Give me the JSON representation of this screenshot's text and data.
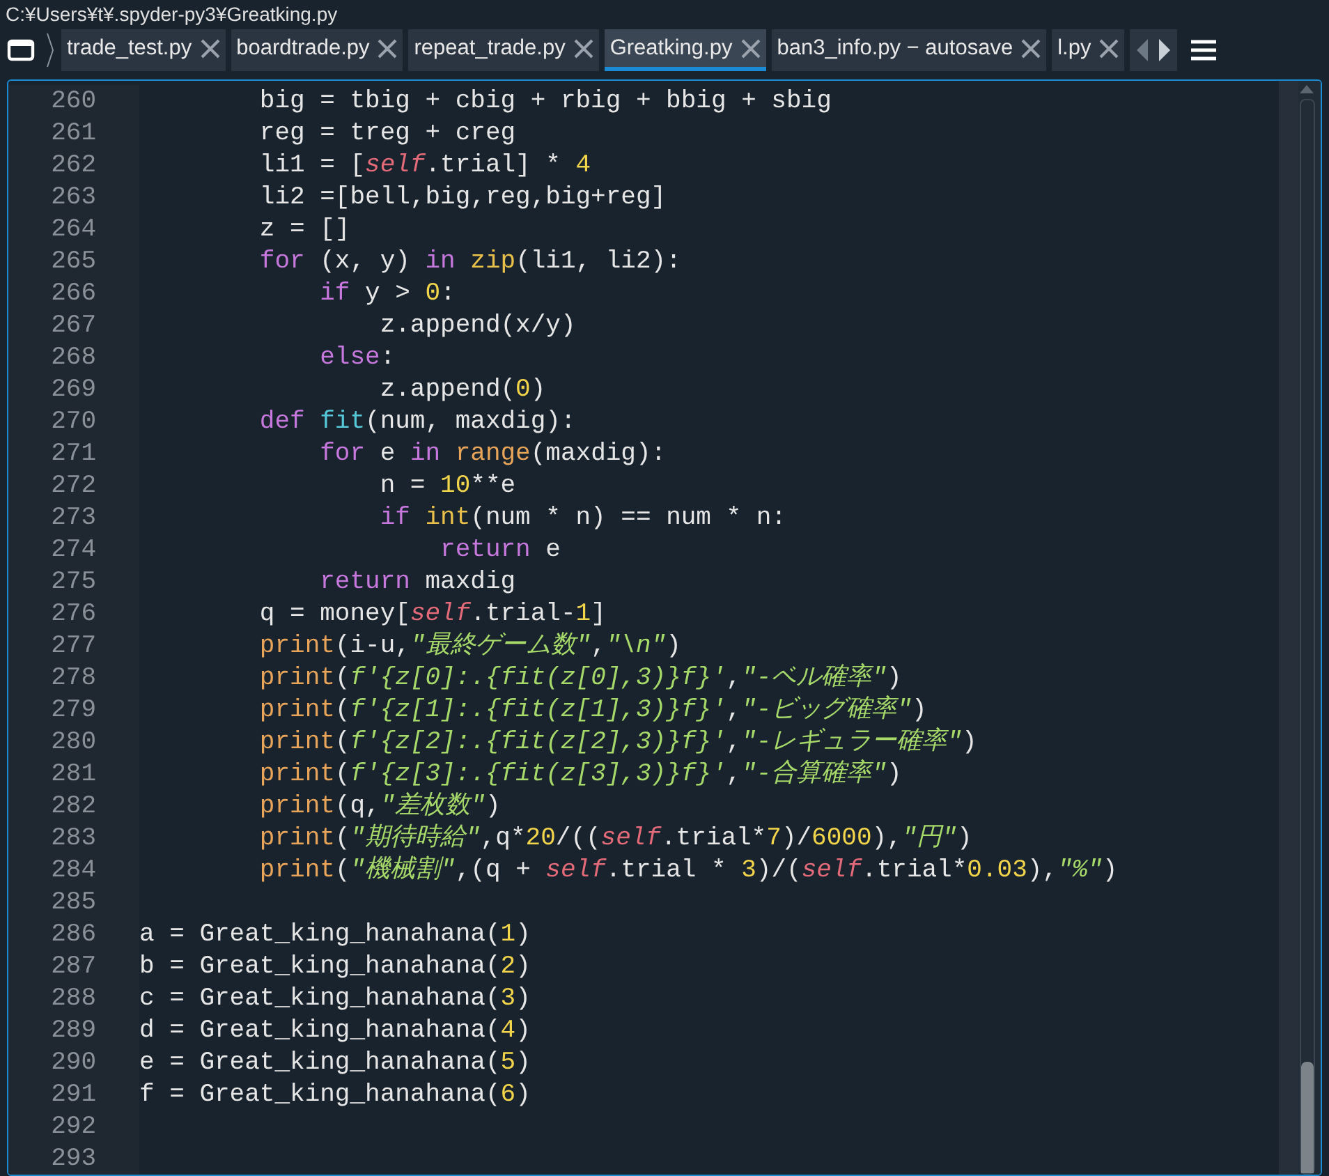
{
  "title_bar": {
    "path": "C:¥Users¥t¥.spyder-py3¥Greatking.py"
  },
  "tabs": [
    {
      "label": "trade_test.py",
      "selected": false
    },
    {
      "label": "boardtrade.py",
      "selected": false
    },
    {
      "label": "repeat_trade.py",
      "selected": false
    },
    {
      "label": "Greatking.py",
      "selected": true
    },
    {
      "label": "ban3_info.py − autosave",
      "selected": false
    },
    {
      "label": "l.py",
      "selected": false
    }
  ],
  "lines": [
    {
      "number": "260",
      "tokens": [
        {
          "kind": "plain",
          "text": "        big = tbig + cbig + rbig + bbig + sbig"
        }
      ]
    },
    {
      "number": "261",
      "tokens": [
        {
          "kind": "plain",
          "text": "        reg = treg + creg"
        }
      ]
    },
    {
      "number": "262",
      "tokens": [
        {
          "kind": "plain",
          "text": "        li1 = ["
        },
        {
          "kind": "self",
          "text": "self"
        },
        {
          "kind": "plain",
          "text": ".trial] * "
        },
        {
          "kind": "number",
          "text": "4"
        }
      ]
    },
    {
      "number": "263",
      "tokens": [
        {
          "kind": "plain",
          "text": "        li2 =[bell,big,reg,big+reg]"
        }
      ]
    },
    {
      "number": "264",
      "tokens": [
        {
          "kind": "plain",
          "text": "        z = []"
        }
      ]
    },
    {
      "number": "265",
      "tokens": [
        {
          "kind": "keyword",
          "text": "        for"
        },
        {
          "kind": "plain",
          "text": " (x, y) "
        },
        {
          "kind": "keyword",
          "text": "in "
        },
        {
          "kind": "builtin",
          "text": "zip"
        },
        {
          "kind": "plain",
          "text": "(li1, li2):"
        }
      ]
    },
    {
      "number": "266",
      "tokens": [
        {
          "kind": "keyword",
          "text": "            if"
        },
        {
          "kind": "plain",
          "text": " y > "
        },
        {
          "kind": "number",
          "text": "0"
        },
        {
          "kind": "plain",
          "text": ":"
        }
      ]
    },
    {
      "number": "267",
      "tokens": [
        {
          "kind": "plain",
          "text": "                z.append(x/y)"
        }
      ]
    },
    {
      "number": "268",
      "tokens": [
        {
          "kind": "keyword",
          "text": "            else"
        },
        {
          "kind": "plain",
          "text": ":"
        }
      ]
    },
    {
      "number": "269",
      "tokens": [
        {
          "kind": "plain",
          "text": "                z.append("
        },
        {
          "kind": "number",
          "text": "0"
        },
        {
          "kind": "plain",
          "text": ")"
        }
      ]
    },
    {
      "number": "270",
      "tokens": [
        {
          "kind": "keyword",
          "text": "        def "
        },
        {
          "kind": "function",
          "text": "fit"
        },
        {
          "kind": "plain",
          "text": "(num, maxdig):"
        }
      ]
    },
    {
      "number": "271",
      "tokens": [
        {
          "kind": "keyword",
          "text": "            for"
        },
        {
          "kind": "plain",
          "text": " e "
        },
        {
          "kind": "keyword",
          "text": "in "
        },
        {
          "kind": "builtin",
          "text": "range"
        },
        {
          "kind": "plain",
          "text": "(maxdig):"
        }
      ]
    },
    {
      "number": "272",
      "tokens": [
        {
          "kind": "plain",
          "text": "                n = "
        },
        {
          "kind": "number",
          "text": "10"
        },
        {
          "kind": "plain",
          "text": "**e"
        }
      ]
    },
    {
      "number": "273",
      "tokens": [
        {
          "kind": "keyword",
          "text": "                if "
        },
        {
          "kind": "builtin",
          "text": "int"
        },
        {
          "kind": "plain",
          "text": "(num * n) == num * n:"
        }
      ]
    },
    {
      "number": "274",
      "tokens": [
        {
          "kind": "keyword",
          "text": "                    return"
        },
        {
          "kind": "plain",
          "text": " e"
        }
      ]
    },
    {
      "number": "275",
      "tokens": [
        {
          "kind": "keyword",
          "text": "            return"
        },
        {
          "kind": "plain",
          "text": " maxdig"
        }
      ]
    },
    {
      "number": "276",
      "tokens": [
        {
          "kind": "plain",
          "text": "        q = money["
        },
        {
          "kind": "self",
          "text": "self"
        },
        {
          "kind": "plain",
          "text": ".trial-"
        },
        {
          "kind": "number",
          "text": "1"
        },
        {
          "kind": "plain",
          "text": "]"
        }
      ]
    },
    {
      "number": "277",
      "tokens": [
        {
          "kind": "builtin",
          "text": "        print"
        },
        {
          "kind": "plain",
          "text": "(i-u,"
        },
        {
          "kind": "string",
          "text": "\"最終ゲーム数\""
        },
        {
          "kind": "plain",
          "text": ","
        },
        {
          "kind": "string",
          "text": "\"\\n\""
        },
        {
          "kind": "plain",
          "text": ")"
        }
      ]
    },
    {
      "number": "278",
      "tokens": [
        {
          "kind": "builtin",
          "text": "        print"
        },
        {
          "kind": "plain",
          "text": "("
        },
        {
          "kind": "string",
          "text": "f'{z[0]:.{fit(z[0],3)}f}'"
        },
        {
          "kind": "plain",
          "text": ","
        },
        {
          "kind": "string",
          "text": "\"-ベル確率\""
        },
        {
          "kind": "plain",
          "text": ")"
        }
      ]
    },
    {
      "number": "279",
      "tokens": [
        {
          "kind": "builtin",
          "text": "        print"
        },
        {
          "kind": "plain",
          "text": "("
        },
        {
          "kind": "string",
          "text": "f'{z[1]:.{fit(z[1],3)}f}'"
        },
        {
          "kind": "plain",
          "text": ","
        },
        {
          "kind": "string",
          "text": "\"-ビッグ確率\""
        },
        {
          "kind": "plain",
          "text": ")"
        }
      ]
    },
    {
      "number": "280",
      "tokens": [
        {
          "kind": "builtin",
          "text": "        print"
        },
        {
          "kind": "plain",
          "text": "("
        },
        {
          "kind": "string",
          "text": "f'{z[2]:.{fit(z[2],3)}f}'"
        },
        {
          "kind": "plain",
          "text": ","
        },
        {
          "kind": "string",
          "text": "\"-レギュラー確率\""
        },
        {
          "kind": "plain",
          "text": ")"
        }
      ]
    },
    {
      "number": "281",
      "tokens": [
        {
          "kind": "builtin",
          "text": "        print"
        },
        {
          "kind": "plain",
          "text": "("
        },
        {
          "kind": "string",
          "text": "f'{z[3]:.{fit(z[3],3)}f}'"
        },
        {
          "kind": "plain",
          "text": ","
        },
        {
          "kind": "string",
          "text": "\"-合算確率\""
        },
        {
          "kind": "plain",
          "text": ")"
        }
      ]
    },
    {
      "number": "282",
      "tokens": [
        {
          "kind": "builtin",
          "text": "        print"
        },
        {
          "kind": "plain",
          "text": "(q,"
        },
        {
          "kind": "string",
          "text": "\"差枚数\""
        },
        {
          "kind": "plain",
          "text": ")"
        }
      ]
    },
    {
      "number": "283",
      "tokens": [
        {
          "kind": "builtin",
          "text": "        print"
        },
        {
          "kind": "plain",
          "text": "("
        },
        {
          "kind": "string",
          "text": "\"期待時給\""
        },
        {
          "kind": "plain",
          "text": ",q*"
        },
        {
          "kind": "number",
          "text": "20"
        },
        {
          "kind": "plain",
          "text": "/(("
        },
        {
          "kind": "self",
          "text": "self"
        },
        {
          "kind": "plain",
          "text": ".trial*"
        },
        {
          "kind": "number",
          "text": "7"
        },
        {
          "kind": "plain",
          "text": ")/"
        },
        {
          "kind": "number",
          "text": "6000"
        },
        {
          "kind": "plain",
          "text": "),"
        },
        {
          "kind": "string",
          "text": "\"円\""
        },
        {
          "kind": "plain",
          "text": ")"
        }
      ]
    },
    {
      "number": "284",
      "tokens": [
        {
          "kind": "builtin",
          "text": "        print"
        },
        {
          "kind": "plain",
          "text": "("
        },
        {
          "kind": "string",
          "text": "\"機械割\""
        },
        {
          "kind": "plain",
          "text": ",(q + "
        },
        {
          "kind": "self",
          "text": "self"
        },
        {
          "kind": "plain",
          "text": ".trial * "
        },
        {
          "kind": "number",
          "text": "3"
        },
        {
          "kind": "plain",
          "text": ")/("
        },
        {
          "kind": "self",
          "text": "self"
        },
        {
          "kind": "plain",
          "text": ".trial*"
        },
        {
          "kind": "number",
          "text": "0.03"
        },
        {
          "kind": "plain",
          "text": "),"
        },
        {
          "kind": "string",
          "text": "\"%\""
        },
        {
          "kind": "plain",
          "text": ")"
        }
      ]
    },
    {
      "number": "285"
    },
    {
      "number": "286",
      "tokens": [
        {
          "kind": "plain",
          "text": "a = Great_king_hanahana("
        },
        {
          "kind": "number",
          "text": "1"
        },
        {
          "kind": "plain",
          "text": ")"
        }
      ]
    },
    {
      "number": "287",
      "tokens": [
        {
          "kind": "plain",
          "text": "b = Great_king_hanahana("
        },
        {
          "kind": "number",
          "text": "2"
        },
        {
          "kind": "plain",
          "text": ")"
        }
      ]
    },
    {
      "number": "288",
      "tokens": [
        {
          "kind": "plain",
          "text": "c = Great_king_hanahana("
        },
        {
          "kind": "number",
          "text": "3"
        },
        {
          "kind": "plain",
          "text": ")"
        }
      ]
    },
    {
      "number": "289",
      "tokens": [
        {
          "kind": "plain",
          "text": "d = Great_king_hanahana("
        },
        {
          "kind": "number",
          "text": "4"
        },
        {
          "kind": "plain",
          "text": ")"
        }
      ]
    },
    {
      "number": "290",
      "tokens": [
        {
          "kind": "plain",
          "text": "e = Great_king_hanahana("
        },
        {
          "kind": "number",
          "text": "5"
        },
        {
          "kind": "plain",
          "text": ")"
        }
      ]
    },
    {
      "number": "291",
      "tokens": [
        {
          "kind": "plain",
          "text": "f = Great_king_hanahana("
        },
        {
          "kind": "number",
          "text": "6"
        },
        {
          "kind": "plain",
          "text": ")"
        }
      ]
    },
    {
      "number": "292"
    },
    {
      "number": "293"
    }
  ]
}
